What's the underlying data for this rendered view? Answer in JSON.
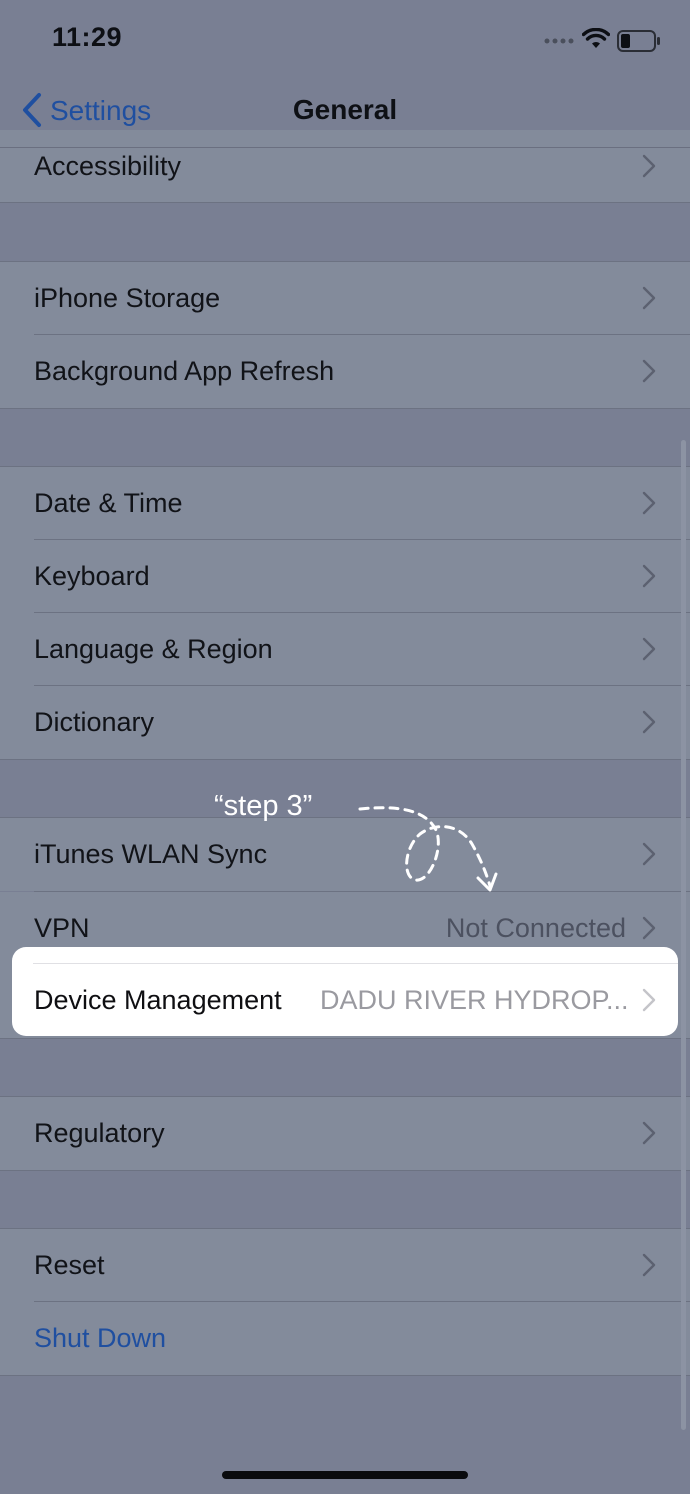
{
  "status_bar": {
    "time": "11:29"
  },
  "nav": {
    "back_label": "Settings",
    "title": "General"
  },
  "rows": [
    {
      "label": "Accessibility",
      "value": ""
    },
    {
      "label": "iPhone Storage",
      "value": ""
    },
    {
      "label": "Background App Refresh",
      "value": ""
    },
    {
      "label": "Date & Time",
      "value": ""
    },
    {
      "label": "Keyboard",
      "value": ""
    },
    {
      "label": "Language & Region",
      "value": ""
    },
    {
      "label": "Dictionary",
      "value": ""
    },
    {
      "label": "iTunes WLAN Sync",
      "value": ""
    },
    {
      "label": "VPN",
      "value": "Not Connected"
    },
    {
      "label": "Device Management",
      "value": "DADU RIVER HYDROP..."
    },
    {
      "label": "Regulatory",
      "value": ""
    },
    {
      "label": "Reset",
      "value": ""
    },
    {
      "label": "Shut Down",
      "value": ""
    }
  ],
  "annotation": {
    "text": "“step 3”"
  },
  "colors": {
    "accent": "#1f4fa0",
    "overlay_bg": "#797f93",
    "highlight_bg": "#ffffff"
  }
}
